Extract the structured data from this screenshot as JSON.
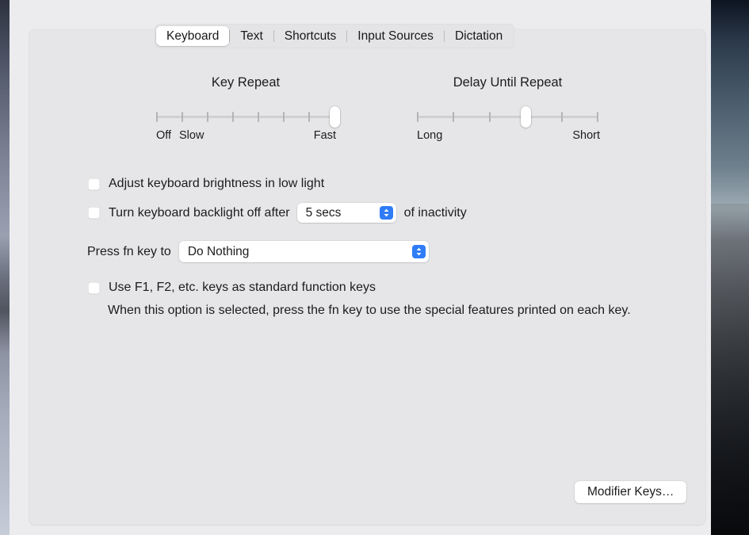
{
  "tabs": [
    {
      "label": "Keyboard",
      "selected": true
    },
    {
      "label": "Text",
      "selected": false
    },
    {
      "label": "Shortcuts",
      "selected": false
    },
    {
      "label": "Input Sources",
      "selected": false
    },
    {
      "label": "Dictation",
      "selected": false
    }
  ],
  "sliders": {
    "key_repeat": {
      "title": "Key Repeat",
      "ticks": 8,
      "value_index": 7,
      "label_left": "Off",
      "label_left2": "Slow",
      "label_right": "Fast"
    },
    "delay_until_repeat": {
      "title": "Delay Until Repeat",
      "ticks": 6,
      "value_index": 3,
      "label_left": "Long",
      "label_right": "Short"
    }
  },
  "options": {
    "adjust_brightness_label": "Adjust keyboard brightness in low light",
    "adjust_brightness_checked": false,
    "backlight_off_label": "Turn keyboard backlight off after",
    "backlight_off_checked": false,
    "backlight_delay_value": "5 secs",
    "backlight_suffix": "of inactivity",
    "fn_key_label": "Press fn key to",
    "fn_key_value": "Do Nothing",
    "function_keys_label": "Use F1, F2, etc. keys as standard function keys",
    "function_keys_checked": false,
    "function_keys_help": "When this option is selected, press the fn key to use the special features printed on each key."
  },
  "buttons": {
    "modifier_keys": "Modifier Keys…"
  },
  "icons": {
    "stepper": "chevron-up-down-icon"
  },
  "colors": {
    "accent_blue": "#2f7cf6",
    "panel_bg": "#e6e6e8",
    "window_bg": "#ececee",
    "text": "#1c1c1e"
  }
}
